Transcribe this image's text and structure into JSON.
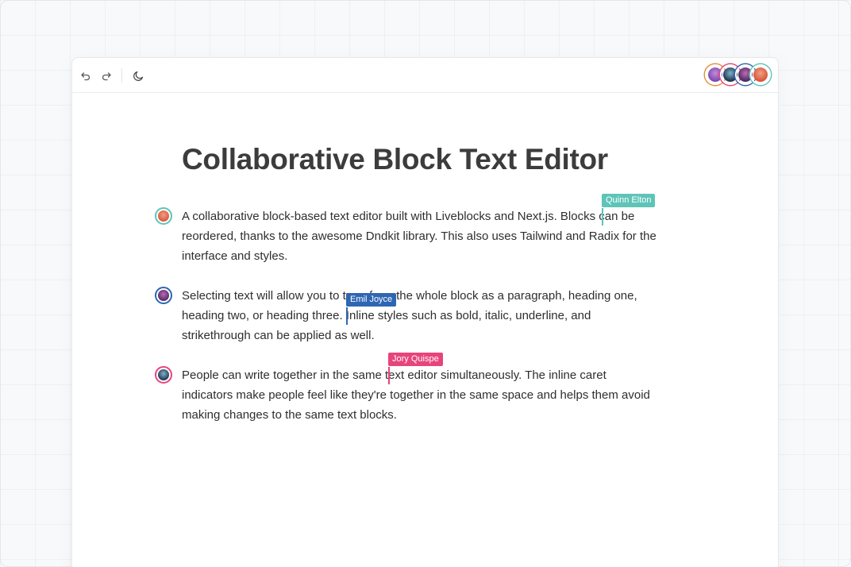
{
  "toolbar": {
    "undo_icon": "undo-icon",
    "redo_icon": "redo-icon",
    "theme_icon": "moon-icon"
  },
  "users": [
    {
      "name": "Jory Quispe",
      "color": "#e7447c"
    },
    {
      "name": "Emil Joyce",
      "color": "#2f66b3"
    },
    {
      "name": "Quinn Elton",
      "color": "#5ec4b8"
    }
  ],
  "document": {
    "title": "Collaborative Block Text Editor",
    "blocks": [
      {
        "lines": [
          "A collaborative block-based text editor built with Liveblocks and Next.js. Blocks can be",
          "reordered, thanks to the awesome Dndkit library. This also uses Tailwind and Radix for the",
          "interface and styles."
        ]
      },
      {
        "lines": [
          "Selecting text will allow you to transform the whole block as a paragraph, heading one,",
          "heading two, or heading three. Inline styles such as bold, italic, underline, and",
          "strikethrough can be applied as well."
        ]
      },
      {
        "lines": [
          "People can write together in the same text editor simultaneously. The inline caret",
          "indicators make people feel like they're together in the same space and helps them avoid",
          "making changes to the same text blocks."
        ]
      }
    ]
  },
  "cursors": [
    {
      "label": "Quinn Elton",
      "color": "#5ec4b8"
    },
    {
      "label": "Emil Joyce",
      "color": "#2f66b3"
    },
    {
      "label": "Jory Quispe",
      "color": "#e7447c"
    }
  ]
}
